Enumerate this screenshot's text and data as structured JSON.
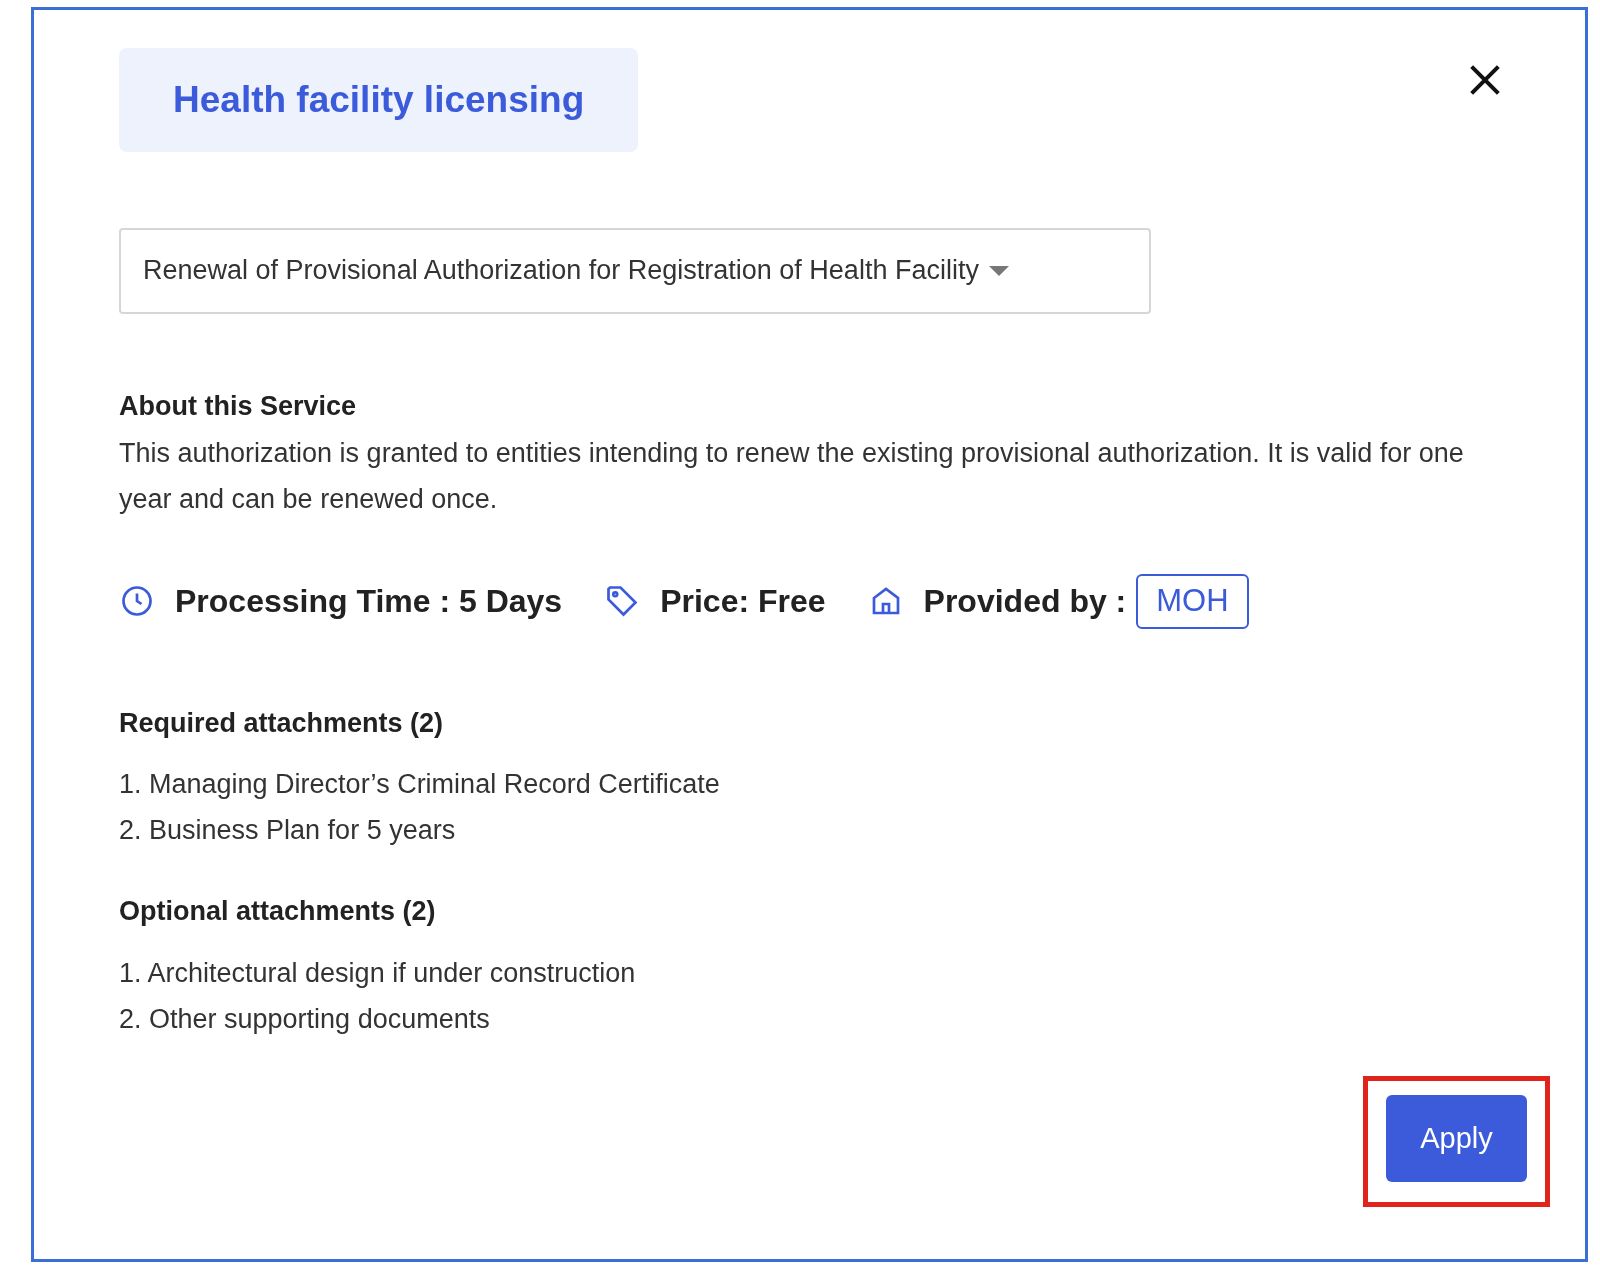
{
  "title": "Health facility licensing",
  "service_select": {
    "value": "Renewal of Provisional Authorization for Registration of Health Facility"
  },
  "about": {
    "heading": "About this Service",
    "text": "This authorization is granted to entities intending to renew the existing provisional authorization. It is valid for one year and can be renewed once."
  },
  "meta": [
    {
      "kind": "time",
      "label": "Processing Time : 5 Days"
    },
    {
      "kind": "price",
      "label": "Price: Free"
    },
    {
      "kind": "provider",
      "label": "Provided by :",
      "badge": "MOH"
    }
  ],
  "required_attachments": {
    "heading": "Required attachments (2)",
    "items": [
      "1. Managing Director’s Criminal Record Certificate",
      "2. Business Plan for 5 years"
    ]
  },
  "optional_attachments": {
    "heading": "Optional attachments (2)",
    "items": [
      "1. Architectural design if under construction",
      "2. Other supporting documents"
    ]
  },
  "apply_button": {
    "label": "Apply",
    "highlighted": true
  }
}
